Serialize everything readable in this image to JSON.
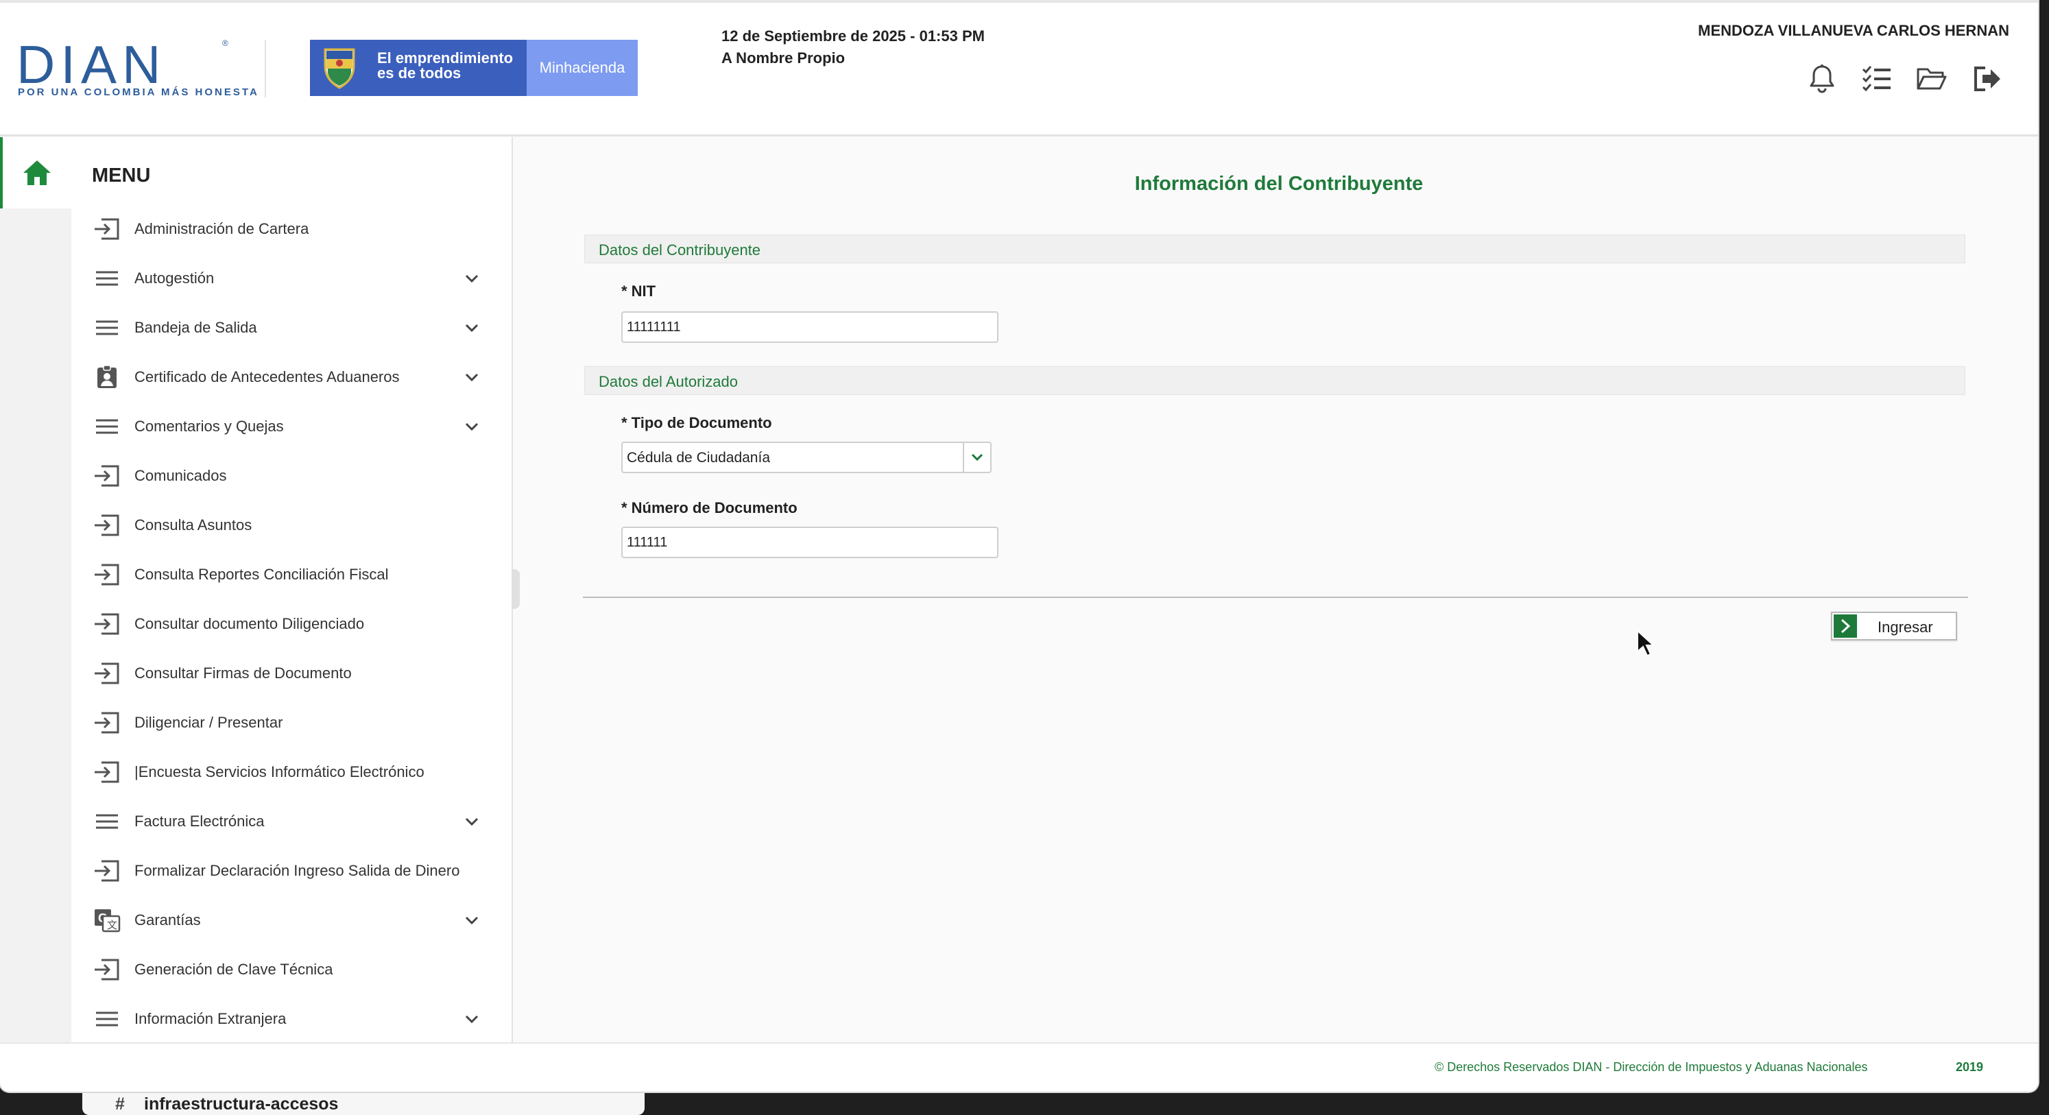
{
  "header": {
    "logo_text": "DIAN",
    "logo_tagline": "POR UNA COLOMBIA MÁS HONESTA",
    "gov_line1": "El emprendimiento",
    "gov_line2": "es de todos",
    "gov_ministry": "Minhacienda",
    "date": "12 de Septiembre de 2025 - 01:53 PM",
    "mode": "A Nombre Propio",
    "user": "MENDOZA VILLANUEVA CARLOS HERNAN",
    "icons": [
      "bell-icon",
      "checklist-icon",
      "folder-open-icon",
      "logout-icon"
    ]
  },
  "sidebar": {
    "title": "MENU",
    "items": [
      {
        "label": "Administración de Cartera",
        "icon": "enter-icon",
        "expandable": false
      },
      {
        "label": "Autogestión",
        "icon": "hamburger-icon",
        "expandable": true
      },
      {
        "label": "Bandeja de Salida",
        "icon": "hamburger-icon",
        "expandable": true
      },
      {
        "label": "Certificado de Antecedentes Aduaneros",
        "icon": "id-badge-icon",
        "expandable": true
      },
      {
        "label": "Comentarios y Quejas",
        "icon": "hamburger-icon",
        "expandable": true
      },
      {
        "label": "Comunicados",
        "icon": "enter-icon",
        "expandable": false
      },
      {
        "label": "Consulta Asuntos",
        "icon": "enter-icon",
        "expandable": false
      },
      {
        "label": "Consulta Reportes Conciliación Fiscal",
        "icon": "enter-icon",
        "expandable": false
      },
      {
        "label": "Consultar documento Diligenciado",
        "icon": "enter-icon",
        "expandable": false
      },
      {
        "label": "Consultar Firmas de Documento",
        "icon": "enter-icon",
        "expandable": false
      },
      {
        "label": "Diligenciar / Presentar",
        "icon": "enter-icon",
        "expandable": false
      },
      {
        "label": "|Encuesta Servicios Informático Electrónico",
        "icon": "enter-icon",
        "expandable": false
      },
      {
        "label": "Factura Electrónica",
        "icon": "hamburger-icon",
        "expandable": true
      },
      {
        "label": "Formalizar Declaración Ingreso Salida de Dinero",
        "icon": "enter-icon",
        "expandable": false
      },
      {
        "label": "Garantías",
        "icon": "translate-icon",
        "expandable": true
      },
      {
        "label": "Generación de Clave Técnica",
        "icon": "enter-icon",
        "expandable": false
      },
      {
        "label": "Información Extranjera",
        "icon": "hamburger-icon",
        "expandable": true
      }
    ]
  },
  "main": {
    "title": "Información del Contribuyente",
    "section_contribuyente": "Datos del Contribuyente",
    "nit_label": "* NIT",
    "nit_value": "11111111",
    "section_autorizado": "Datos del Autorizado",
    "tipo_doc_label": "* Tipo de Documento",
    "tipo_doc_value": "Cédula de Ciudadanía",
    "num_doc_label": "* Número de Documento",
    "num_doc_value": "111111",
    "submit_label": "Ingresar"
  },
  "footer": {
    "copyright": "© Derechos Reservados DIAN - Dirección de Impuestos y Aduanas Nacionales",
    "year": "2019"
  },
  "background_window": {
    "hash": "#",
    "channel": "infraestructura-accesos"
  },
  "colors": {
    "brand_green": "#1f7a3a",
    "dian_blue": "#2d5d9b",
    "gov_blue": "#3b5fbd",
    "gov_light_blue": "#7d9bf0"
  }
}
